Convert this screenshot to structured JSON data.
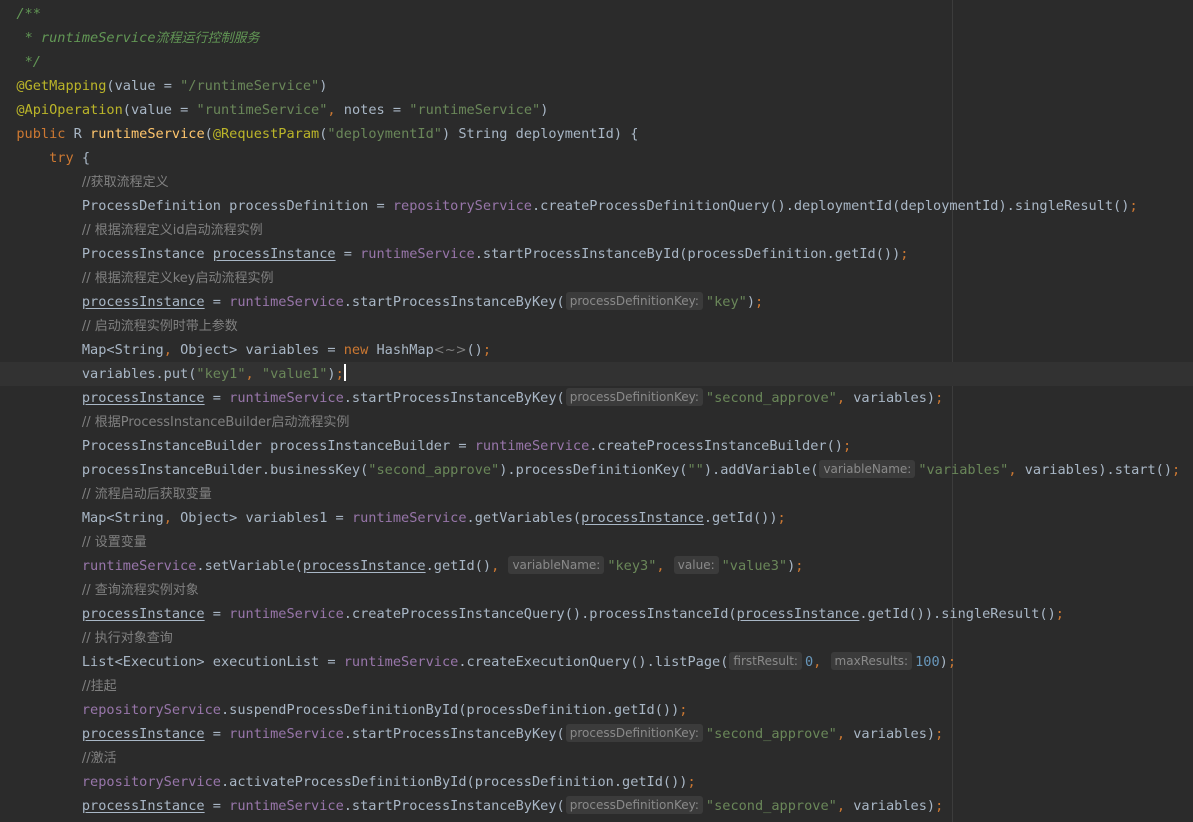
{
  "editor": {
    "language": "Java",
    "theme": "Darcula",
    "colors": {
      "background": "#2b2b2b",
      "current_line": "#323232",
      "text": "#a9b7c6",
      "keyword": "#cc7832",
      "annotation": "#bbb529",
      "string": "#6a8759",
      "comment": "#808080",
      "doc_comment": "#629755",
      "field": "#9876aa",
      "method_declaration": "#ffc66d",
      "number": "#6897bb",
      "inlay_hint_background": "#3b3b3b",
      "inlay_hint_text": "#8a8a8a"
    },
    "lines": [
      {
        "indent": "  ",
        "current": false,
        "tokens": [
          [
            "doc",
            "/**"
          ]
        ]
      },
      {
        "indent": "   ",
        "current": false,
        "tokens": [
          [
            "doc",
            "* runtimeService"
          ],
          [
            "doc-text",
            "流程运行控制服务"
          ]
        ]
      },
      {
        "indent": "   ",
        "current": false,
        "tokens": [
          [
            "doc",
            "*/"
          ]
        ]
      },
      {
        "indent": "  ",
        "current": false,
        "tokens": [
          [
            "ann",
            "@GetMapping"
          ],
          [
            "p",
            "("
          ],
          [
            "p",
            "value = "
          ],
          [
            "str",
            "\"/runtimeService\""
          ],
          [
            "p",
            ")"
          ]
        ]
      },
      {
        "indent": "  ",
        "current": false,
        "tokens": [
          [
            "ann",
            "@ApiOperation"
          ],
          [
            "p",
            "("
          ],
          [
            "p",
            "value = "
          ],
          [
            "str",
            "\"runtimeService\""
          ],
          [
            "kw",
            ", "
          ],
          [
            "p",
            "notes = "
          ],
          [
            "str",
            "\"runtimeService\""
          ],
          [
            "p",
            ")"
          ]
        ]
      },
      {
        "indent": "  ",
        "current": false,
        "tokens": [
          [
            "kw",
            "public "
          ],
          [
            "p",
            "R "
          ],
          [
            "mth",
            "runtimeService"
          ],
          [
            "p",
            "("
          ],
          [
            "ann",
            "@RequestParam"
          ],
          [
            "p",
            "("
          ],
          [
            "str",
            "\"deploymentId\""
          ],
          [
            "p",
            ") String deploymentId) {"
          ]
        ]
      },
      {
        "indent": "      ",
        "current": false,
        "tokens": [
          [
            "kw",
            "try "
          ],
          [
            "p",
            "{"
          ]
        ]
      },
      {
        "indent": "          ",
        "current": false,
        "tokens": [
          [
            "cmt",
            "//获取流程定义"
          ]
        ]
      },
      {
        "indent": "          ",
        "current": false,
        "tokens": [
          [
            "p",
            "ProcessDefinition processDefinition = "
          ],
          [
            "fld",
            "repositoryService"
          ],
          [
            "p",
            ".createProcessDefinitionQuery().deploymentId(deploymentId).singleResult()"
          ],
          [
            "kw",
            ";"
          ]
        ]
      },
      {
        "indent": "          ",
        "current": false,
        "tokens": [
          [
            "cmt",
            "// 根据流程定义id启动流程实例"
          ]
        ]
      },
      {
        "indent": "          ",
        "current": false,
        "tokens": [
          [
            "p",
            "ProcessInstance "
          ],
          [
            "var",
            "processInstance"
          ],
          [
            "p",
            " = "
          ],
          [
            "fld",
            "runtimeService"
          ],
          [
            "p",
            ".startProcessInstanceById(processDefinition.getId())"
          ],
          [
            "kw",
            ";"
          ]
        ]
      },
      {
        "indent": "          ",
        "current": false,
        "tokens": [
          [
            "cmt",
            "// 根据流程定义key启动流程实例"
          ]
        ]
      },
      {
        "indent": "          ",
        "current": false,
        "tokens": [
          [
            "var",
            "processInstance"
          ],
          [
            "p",
            " = "
          ],
          [
            "fld",
            "runtimeService"
          ],
          [
            "p",
            ".startProcessInstanceByKey("
          ],
          [
            "hint",
            "processDefinitionKey:"
          ],
          [
            "str",
            "\"key\""
          ],
          [
            "p",
            ")"
          ],
          [
            "kw",
            ";"
          ]
        ]
      },
      {
        "indent": "          ",
        "current": false,
        "tokens": [
          [
            "cmt",
            "// 启动流程实例时带上参数"
          ]
        ]
      },
      {
        "indent": "          ",
        "current": false,
        "tokens": [
          [
            "p",
            "Map<String"
          ],
          [
            "kw",
            ", "
          ],
          [
            "p",
            "Object> variables = "
          ],
          [
            "kw",
            "new "
          ],
          [
            "p",
            "HashMap"
          ],
          [
            "cmt-gray",
            "<~>"
          ],
          [
            "p",
            "()"
          ],
          [
            "kw",
            ";"
          ]
        ]
      },
      {
        "indent": "          ",
        "current": true,
        "tokens": [
          [
            "p",
            "variables.put("
          ],
          [
            "str",
            "\"key1\""
          ],
          [
            "kw",
            ", "
          ],
          [
            "str",
            "\"value1\""
          ],
          [
            "p",
            ")"
          ],
          [
            "kw",
            ";"
          ],
          [
            "caret",
            ""
          ]
        ]
      },
      {
        "indent": "          ",
        "current": false,
        "tokens": [
          [
            "var",
            "processInstance"
          ],
          [
            "p",
            " = "
          ],
          [
            "fld",
            "runtimeService"
          ],
          [
            "p",
            ".startProcessInstanceByKey("
          ],
          [
            "hint",
            "processDefinitionKey:"
          ],
          [
            "str",
            "\"second_approve\""
          ],
          [
            "kw",
            ", "
          ],
          [
            "p",
            "variables)"
          ],
          [
            "kw",
            ";"
          ]
        ]
      },
      {
        "indent": "          ",
        "current": false,
        "tokens": [
          [
            "cmt",
            "// 根据ProcessInstanceBuilder启动流程实例"
          ]
        ]
      },
      {
        "indent": "          ",
        "current": false,
        "tokens": [
          [
            "p",
            "ProcessInstanceBuilder processInstanceBuilder = "
          ],
          [
            "fld",
            "runtimeService"
          ],
          [
            "p",
            ".createProcessInstanceBuilder()"
          ],
          [
            "kw",
            ";"
          ]
        ]
      },
      {
        "indent": "          ",
        "current": false,
        "tokens": [
          [
            "p",
            "processInstanceBuilder.businessKey("
          ],
          [
            "str",
            "\"second_approve\""
          ],
          [
            "p",
            ").processDefinitionKey("
          ],
          [
            "str",
            "\"\""
          ],
          [
            "p",
            ").addVariable("
          ],
          [
            "hint",
            "variableName:"
          ],
          [
            "str",
            "\"variables\""
          ],
          [
            "kw",
            ", "
          ],
          [
            "p",
            "variables).start()"
          ],
          [
            "kw",
            ";"
          ]
        ]
      },
      {
        "indent": "          ",
        "current": false,
        "tokens": [
          [
            "cmt",
            "// 流程启动后获取变量"
          ]
        ]
      },
      {
        "indent": "          ",
        "current": false,
        "tokens": [
          [
            "p",
            "Map<String"
          ],
          [
            "kw",
            ", "
          ],
          [
            "p",
            "Object> variables1 = "
          ],
          [
            "fld",
            "runtimeService"
          ],
          [
            "p",
            ".getVariables("
          ],
          [
            "var",
            "processInstance"
          ],
          [
            "p",
            ".getId())"
          ],
          [
            "kw",
            ";"
          ]
        ]
      },
      {
        "indent": "          ",
        "current": false,
        "tokens": [
          [
            "cmt",
            "// 设置变量"
          ]
        ]
      },
      {
        "indent": "          ",
        "current": false,
        "tokens": [
          [
            "fld",
            "runtimeService"
          ],
          [
            "p",
            ".setVariable("
          ],
          [
            "var",
            "processInstance"
          ],
          [
            "p",
            ".getId()"
          ],
          [
            "kw",
            ", "
          ],
          [
            "hint",
            "variableName:"
          ],
          [
            "str",
            "\"key3\""
          ],
          [
            "kw",
            ", "
          ],
          [
            "hint",
            "value:"
          ],
          [
            "str",
            "\"value3\""
          ],
          [
            "p",
            ")"
          ],
          [
            "kw",
            ";"
          ]
        ]
      },
      {
        "indent": "          ",
        "current": false,
        "tokens": [
          [
            "cmt",
            "// 查询流程实例对象"
          ]
        ]
      },
      {
        "indent": "          ",
        "current": false,
        "tokens": [
          [
            "var",
            "processInstance"
          ],
          [
            "p",
            " = "
          ],
          [
            "fld",
            "runtimeService"
          ],
          [
            "p",
            ".createProcessInstanceQuery().processInstanceId("
          ],
          [
            "var",
            "processInstance"
          ],
          [
            "p",
            ".getId()).singleResult()"
          ],
          [
            "kw",
            ";"
          ]
        ]
      },
      {
        "indent": "          ",
        "current": false,
        "tokens": [
          [
            "cmt",
            "// 执行对象查询"
          ]
        ]
      },
      {
        "indent": "          ",
        "current": false,
        "tokens": [
          [
            "p",
            "List<Execution> executionList = "
          ],
          [
            "fld",
            "runtimeService"
          ],
          [
            "p",
            ".createExecutionQuery().listPage("
          ],
          [
            "hint",
            "firstResult:"
          ],
          [
            "num",
            "0"
          ],
          [
            "kw",
            ", "
          ],
          [
            "hint",
            "maxResults:"
          ],
          [
            "num",
            "100"
          ],
          [
            "p",
            ")"
          ],
          [
            "kw",
            ";"
          ]
        ]
      },
      {
        "indent": "          ",
        "current": false,
        "tokens": [
          [
            "cmt",
            "//挂起"
          ]
        ]
      },
      {
        "indent": "          ",
        "current": false,
        "tokens": [
          [
            "fld",
            "repositoryService"
          ],
          [
            "p",
            ".suspendProcessDefinitionById(processDefinition.getId())"
          ],
          [
            "kw",
            ";"
          ]
        ]
      },
      {
        "indent": "          ",
        "current": false,
        "tokens": [
          [
            "var",
            "processInstance"
          ],
          [
            "p",
            " = "
          ],
          [
            "fld",
            "runtimeService"
          ],
          [
            "p",
            ".startProcessInstanceByKey("
          ],
          [
            "hint",
            "processDefinitionKey:"
          ],
          [
            "str",
            "\"second_approve\""
          ],
          [
            "kw",
            ", "
          ],
          [
            "p",
            "variables)"
          ],
          [
            "kw",
            ";"
          ]
        ]
      },
      {
        "indent": "          ",
        "current": false,
        "tokens": [
          [
            "cmt",
            "//激活"
          ]
        ]
      },
      {
        "indent": "          ",
        "current": false,
        "tokens": [
          [
            "fld",
            "repositoryService"
          ],
          [
            "p",
            ".activateProcessDefinitionById(processDefinition.getId())"
          ],
          [
            "kw",
            ";"
          ]
        ]
      },
      {
        "indent": "          ",
        "current": false,
        "tokens": [
          [
            "var",
            "processInstance"
          ],
          [
            "p",
            " = "
          ],
          [
            "fld",
            "runtimeService"
          ],
          [
            "p",
            ".startProcessInstanceByKey("
          ],
          [
            "hint",
            "processDefinitionKey:"
          ],
          [
            "str",
            "\"second_approve\""
          ],
          [
            "kw",
            ", "
          ],
          [
            "p",
            "variables)"
          ],
          [
            "kw",
            ";"
          ]
        ]
      }
    ]
  }
}
